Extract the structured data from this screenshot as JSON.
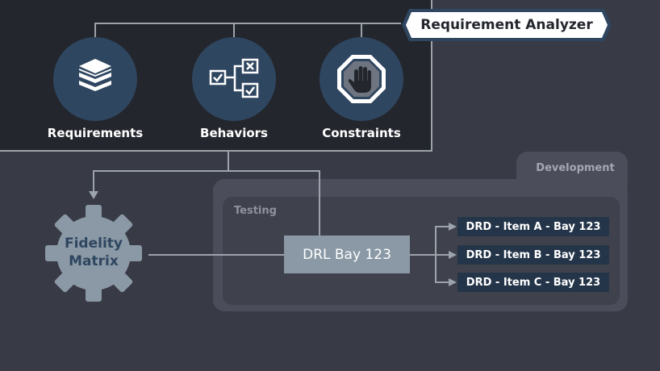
{
  "analyzer": {
    "title": "Requirement Analyzer",
    "categories": [
      {
        "label": "Requirements",
        "icon": "stacked-layers-icon"
      },
      {
        "label": "Behaviors",
        "icon": "checklist-flow-icon"
      },
      {
        "label": "Constraints",
        "icon": "stop-hand-icon"
      }
    ]
  },
  "fidelity": {
    "line1": "Fidelity",
    "line2": "Matrix",
    "icon": "gear-icon"
  },
  "development": {
    "label": "Development"
  },
  "testing": {
    "label": "Testing"
  },
  "drl": {
    "label": "DRL Bay 123"
  },
  "drd_items": [
    "DRD - Item A - Bay 123",
    "DRD - Item B - Bay 123",
    "DRD - Item C - Bay 123"
  ],
  "colors": {
    "background": "#383a45",
    "panel": "#23262d",
    "accent_circle": "#2f4660",
    "connector": "#9ca3ab",
    "drd_box": "#243549",
    "drl_box": "#8a99a5",
    "gear": "#8a99a5"
  }
}
